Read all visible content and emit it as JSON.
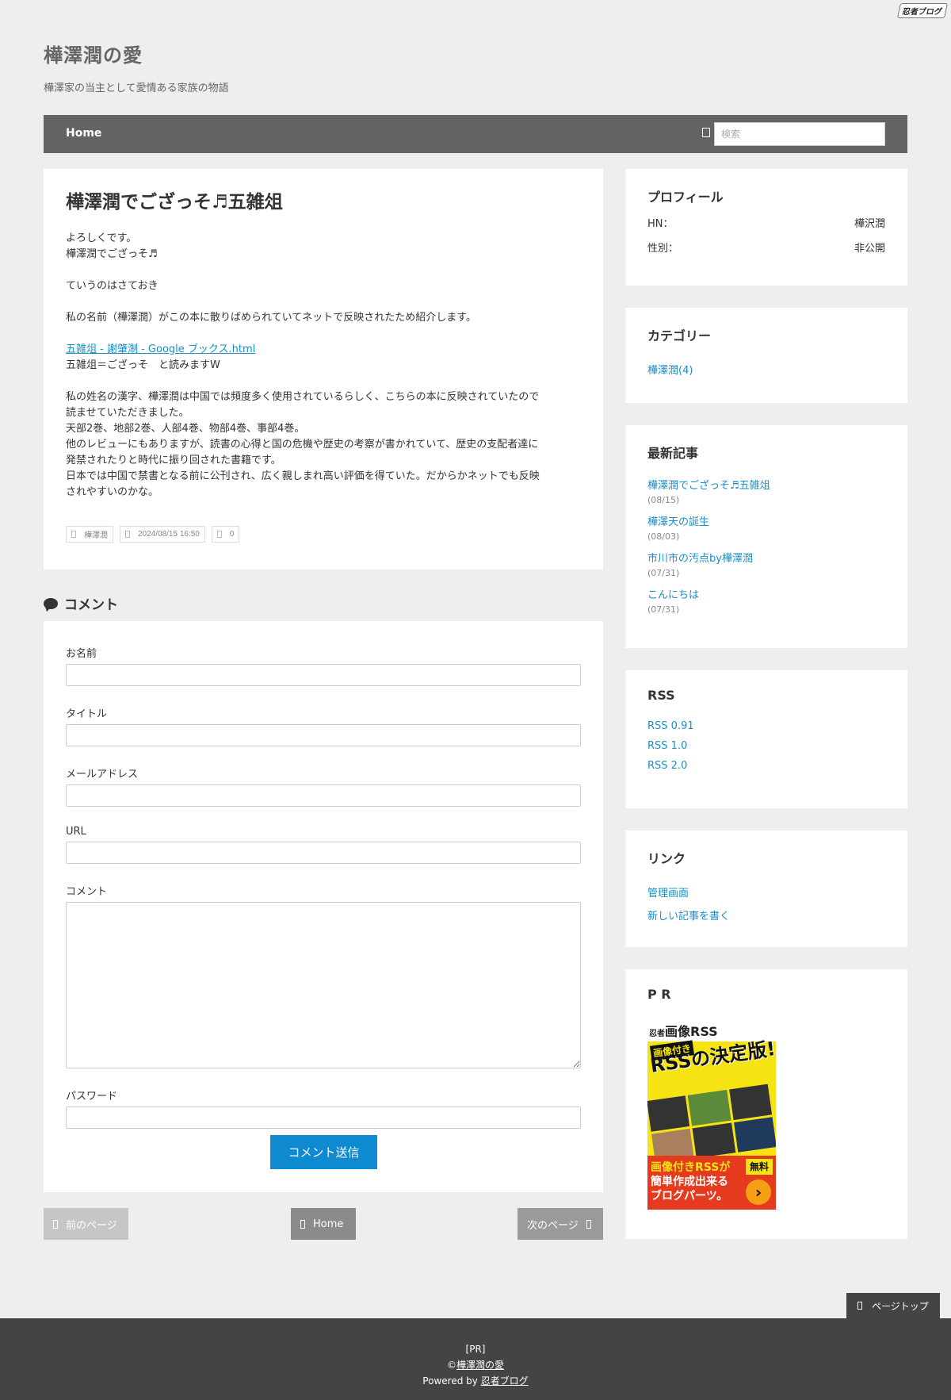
{
  "badge": "忍者ブログ",
  "site": {
    "title": "樺澤潤の愛",
    "description": "樺澤家の当主として愛情ある家族の物語"
  },
  "nav": {
    "home": "Home",
    "search_placeholder": "検索"
  },
  "article": {
    "title": "樺澤潤でござっそ♬五雑俎",
    "lines": {
      "l1": "よろしくです。",
      "l2": "樺澤潤でござっそ♬",
      "l3": "ていうのはさておき",
      "l4": "私の名前（樺澤潤）がこの本に散りばめられていてネットで反映されたため紹介します。",
      "link": "五雑俎 - 謝肇淛 - Google ブックス.html",
      "l5": "五雑俎＝ござっそ　と読みますW",
      "l6": "私の姓名の漢字、樺澤潤は中国では頻度多く使用されているらしく、こちらの本に反映されていたので",
      "l7": "読ませていただきました。",
      "l8": "天部2巻、地部2巻、人部4巻、物部4巻、事部4巻。",
      "l9": "他のレビューにもありますが、読書の心得と国の危機や歴史の考察が書かれていて、歴史の支配者達に",
      "l10": "発禁されたりと時代に振り回された書籍です。",
      "l11": "日本では中国で禁書となる前に公刊され、広く親しまれ高い評価を得ていた。だからかネットでも反映",
      "l12": "されやすいのかな。"
    },
    "meta": {
      "category": "樺澤潤",
      "date": "2024/08/15 16:50",
      "comments": "0"
    }
  },
  "comments": {
    "heading": "コメント",
    "fields": {
      "name": "お名前",
      "title": "タイトル",
      "email": "メールアドレス",
      "url": "URL",
      "comment": "コメント",
      "password": "パスワード"
    },
    "submit": "コメント送信"
  },
  "pager": {
    "prev": "前のページ",
    "home": "Home",
    "next": "次のページ"
  },
  "sidebar": {
    "profile": {
      "title": "プロフィール",
      "rows": [
        {
          "label": "HN：",
          "value": "樺沢潤"
        },
        {
          "label": "性別：",
          "value": "非公開"
        }
      ]
    },
    "category": {
      "title": "カテゴリー",
      "items": [
        "樺澤潤(4)"
      ]
    },
    "recent": {
      "title": "最新記事",
      "items": [
        {
          "title": "樺澤潤でござっそ♬五雑俎",
          "date": "(08/15)"
        },
        {
          "title": "樺澤天の誕生",
          "date": "(08/03)"
        },
        {
          "title": "市川市の汚点by樺澤潤",
          "date": "(07/31)"
        },
        {
          "title": "こんにちは",
          "date": "(07/31)"
        }
      ]
    },
    "rss": {
      "title": "RSS",
      "items": [
        "RSS 0.91",
        "RSS 1.0",
        "RSS 2.0"
      ]
    },
    "links": {
      "title": "リンク",
      "items": [
        "管理画面",
        "新しい記事を書く"
      ]
    },
    "pr": {
      "title": "P R",
      "ad": {
        "brand_small": "忍者",
        "brand": "画像RSS",
        "sub": "画像付き",
        "headline": "RSSの決定版!",
        "bottom1": "画像付きRSSが",
        "bottom2": "簡単作成出来る",
        "bottom3": "ブログパーツ。",
        "free": "無料",
        "arrow": "›"
      }
    }
  },
  "pagetop": "ページトップ",
  "footer": {
    "pr": "[PR]",
    "copyright_prefix": "©",
    "copyright_link": "樺澤潤の愛",
    "powered_prefix": "Powered by ",
    "powered_link": "忍者ブログ"
  }
}
